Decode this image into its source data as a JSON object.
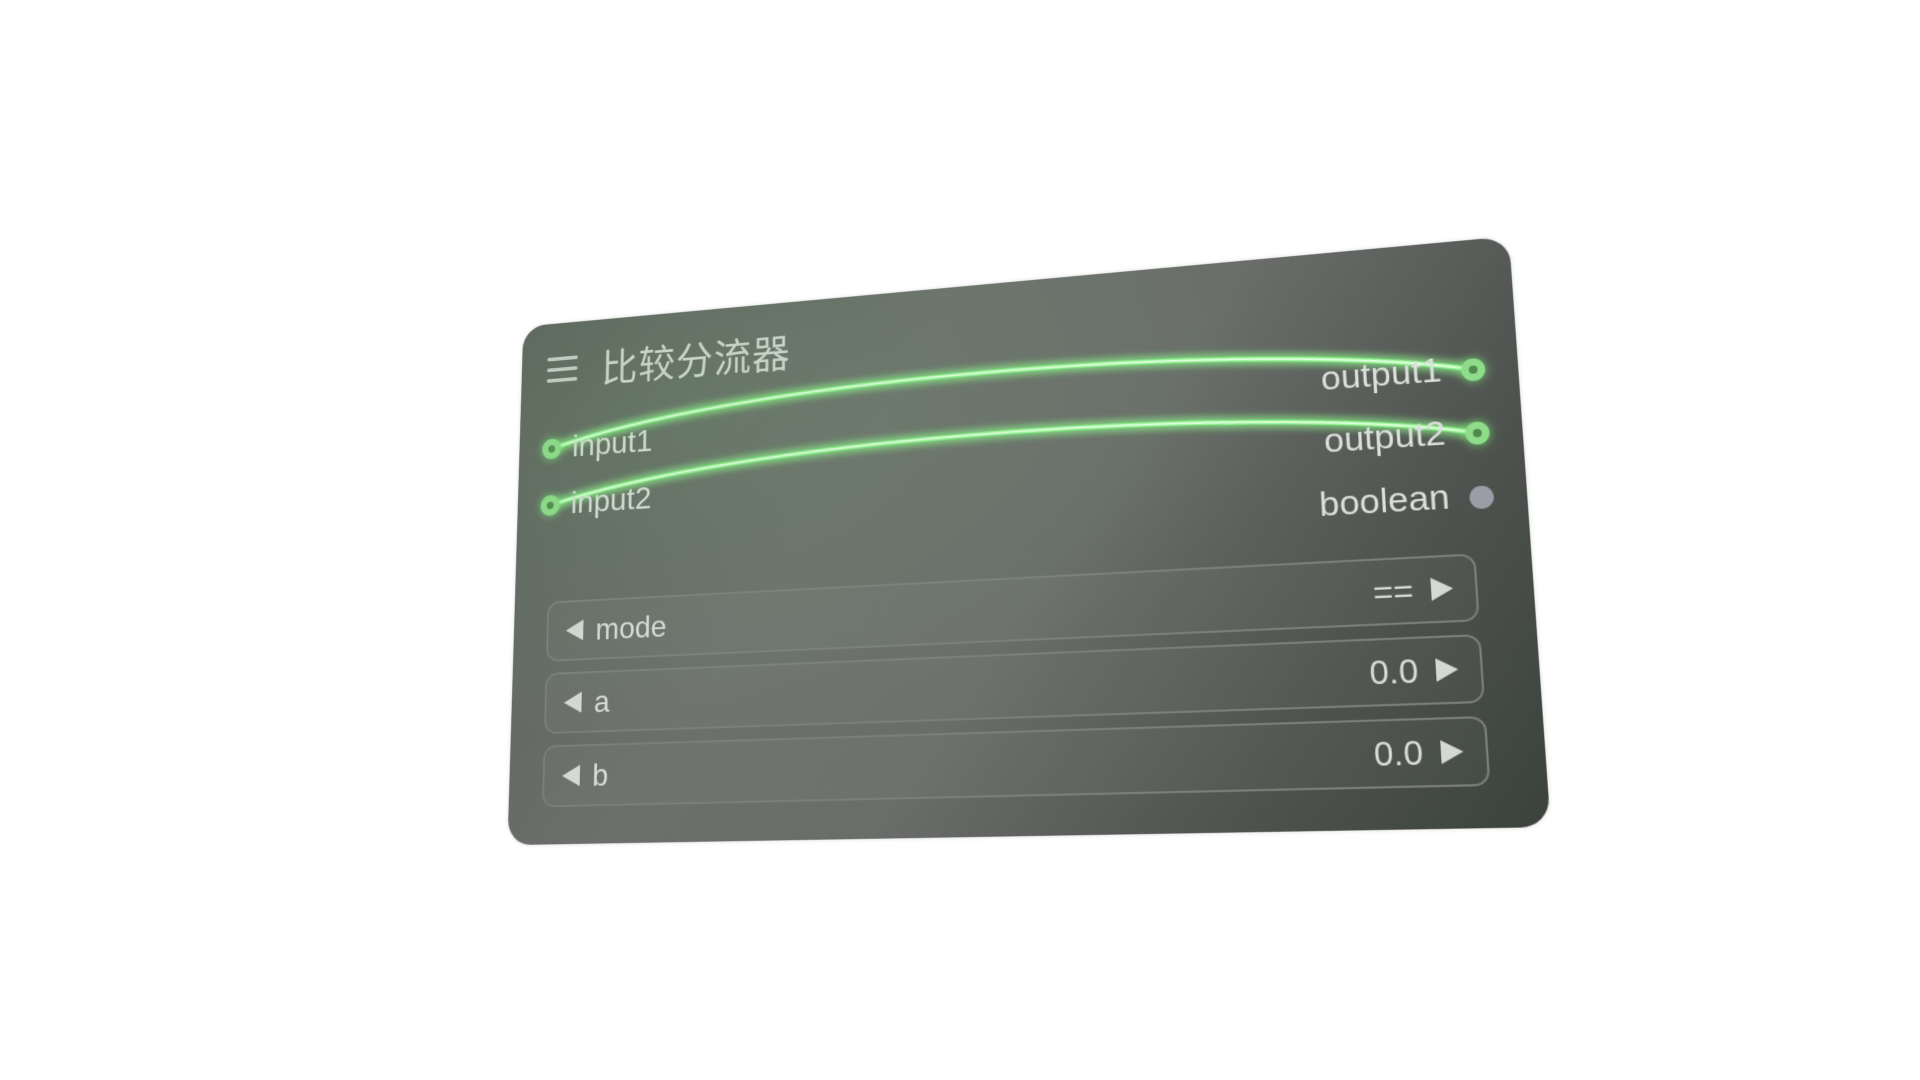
{
  "node": {
    "title": "比较分流器",
    "inputs": [
      {
        "label": "input1"
      },
      {
        "label": "input2"
      }
    ],
    "outputs": [
      {
        "label": "output1"
      },
      {
        "label": "output2"
      },
      {
        "label": "boolean"
      }
    ],
    "widgets": [
      {
        "label": "mode",
        "value": "=="
      },
      {
        "label": "a",
        "value": "0.0"
      },
      {
        "label": "b",
        "value": "0.0"
      }
    ]
  },
  "colors": {
    "link": "#8cf58a",
    "slot_connected": "#8fdc8a",
    "slot_unconnected": "#9a9ca8",
    "node_bg": "#666a66"
  },
  "icons": {
    "menu": "hamburger-menu-icon",
    "widget_decrement": "triangle-left-icon",
    "widget_increment": "triangle-right-icon"
  }
}
